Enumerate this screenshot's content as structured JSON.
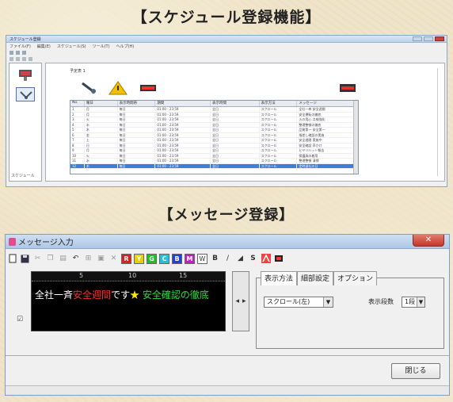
{
  "section1_title": "【スケジュール登録機能】",
  "section2_title": "【メッセージ登録】",
  "schedule_window": {
    "title": "スケジュール登録",
    "menu": [
      "ファイル(F)",
      "編集(E)",
      "スケジュール(S)",
      "ツール(T)",
      "ヘルプ(H)"
    ],
    "left_bottom": "スケジュール",
    "group_label": "予定表 1",
    "columns": [
      "No.",
      "曜日",
      "表示時間帯",
      "期間",
      "表示時間",
      "表示方法",
      "メッセージ"
    ],
    "rows": [
      [
        "1",
        "月",
        "毎日",
        "01:00 - 23:59",
        "全日",
        "スクロール",
        "全社一斉 安全週間"
      ],
      [
        "2",
        "月",
        "毎日",
        "01:00 - 23:59",
        "全日",
        "スクロール",
        "安全運転の徹底"
      ],
      [
        "3",
        "火",
        "毎日",
        "01:00 - 23:59",
        "全日",
        "スクロール",
        "火の用心 点検強化"
      ],
      [
        "4",
        "水",
        "毎日",
        "01:00 - 23:59",
        "全日",
        "スクロール",
        "整理整頓の徹底"
      ],
      [
        "5",
        "木",
        "毎日",
        "01:00 - 23:59",
        "全日",
        "スクロール",
        "品質第一 安全第一"
      ],
      [
        "6",
        "金",
        "毎日",
        "01:00 - 23:59",
        "全日",
        "スクロール",
        "指差し確認の実施"
      ],
      [
        "7",
        "土",
        "毎日",
        "01:00 - 23:59",
        "全日",
        "スクロール",
        "安全週間 実施中"
      ],
      [
        "8",
        "日",
        "毎日",
        "01:00 - 23:59",
        "全日",
        "スクロール",
        "安全確認 声かけ"
      ],
      [
        "9",
        "月",
        "毎日",
        "01:00 - 23:59",
        "全日",
        "スクロール",
        "ヒヤリハット報告"
      ],
      [
        "10",
        "火",
        "毎日",
        "01:00 - 23:59",
        "全日",
        "スクロール",
        "保護具の着用"
      ],
      [
        "11",
        "水",
        "毎日",
        "01:00 - 23:59",
        "全日",
        "スクロール",
        "整理整頓 清掃"
      ],
      [
        "12",
        "木",
        "毎日",
        "01:00 - 23:59",
        "全日",
        "スクロール",
        "定時退社の日"
      ]
    ]
  },
  "message_window": {
    "title": "メッセージ入力",
    "close_x": "✕",
    "ruler": [
      "5",
      "10",
      "15"
    ],
    "message_segments": {
      "white1": "全社一斉",
      "red": "安全週間",
      "white2": "です",
      "star": "★",
      "green": "安全確認の徹底"
    },
    "color_buttons": [
      {
        "label": "R",
        "color": "#e02020"
      },
      {
        "label": "Y",
        "color": "#e8d000"
      },
      {
        "label": "G",
        "color": "#20c020"
      },
      {
        "label": "C",
        "color": "#20c0e0"
      },
      {
        "label": "B",
        "color": "#2040e0"
      },
      {
        "label": "M",
        "color": "#c020c0"
      },
      {
        "label": "W",
        "color": "#ffffff"
      }
    ],
    "style_buttons": [
      "B",
      "/",
      "◢",
      "S"
    ],
    "tabs": [
      "表示方法",
      "細部設定",
      "オプション"
    ],
    "display_method": "スクロール(左)",
    "rows_label": "表示段数",
    "rows_value": "1段",
    "checkbox_mark": "☑",
    "arrow_left": "◂",
    "arrow_right": "▸",
    "close_button": "閉じる"
  }
}
